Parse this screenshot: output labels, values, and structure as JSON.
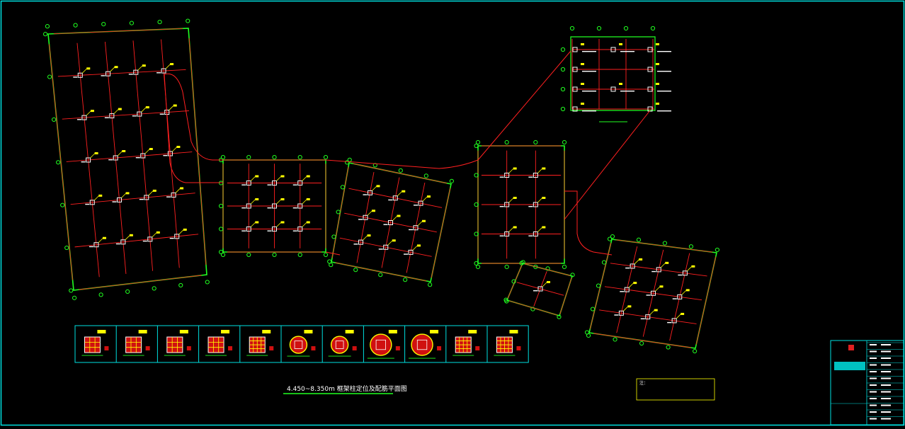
{
  "drawing": {
    "title": "4.450~8.350m 框架柱定位及配筋平面图",
    "frame_color": "#00e0e0",
    "grid_color": "#ff2020",
    "axis_color": "#20ff20",
    "column_color": "#ffffff",
    "label_color": "#ffff00"
  },
  "legend": {
    "sections": [
      {
        "kind": "square",
        "grid": 3
      },
      {
        "kind": "square",
        "grid": 3
      },
      {
        "kind": "square",
        "grid": 3
      },
      {
        "kind": "square",
        "grid": 3
      },
      {
        "kind": "square",
        "grid": 4
      },
      {
        "kind": "circle",
        "grid": 2
      },
      {
        "kind": "circle",
        "grid": 2
      },
      {
        "kind": "circle",
        "grid": 3
      },
      {
        "kind": "circle",
        "grid": 3
      },
      {
        "kind": "square",
        "grid": 4
      },
      {
        "kind": "square",
        "grid": 4
      }
    ]
  },
  "notes": {
    "heading": "注："
  }
}
